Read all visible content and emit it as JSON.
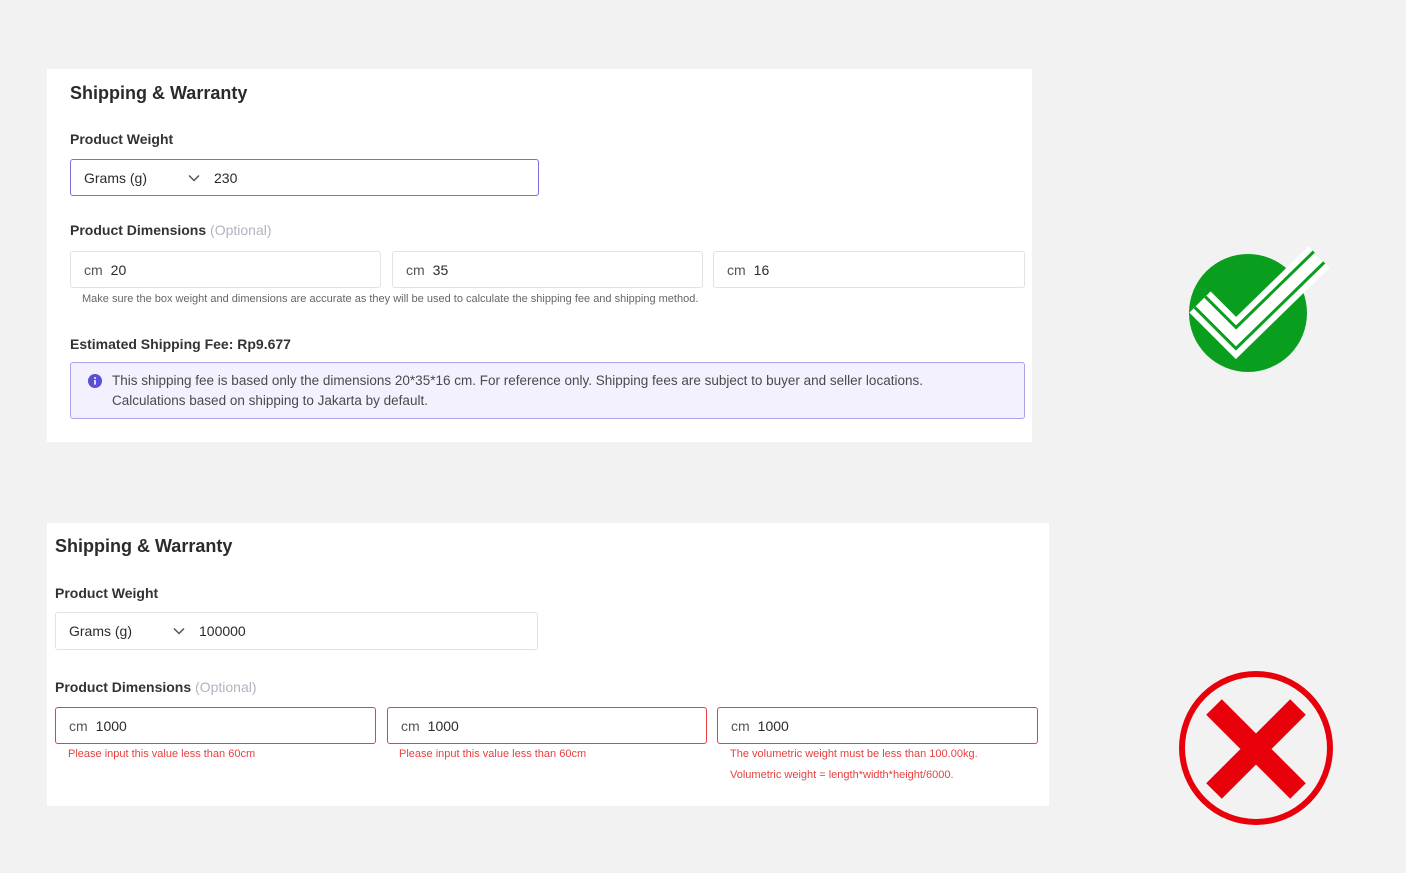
{
  "valid_example": {
    "section_title": "Shipping & Warranty",
    "weight_label": "Product Weight",
    "weight_unit": "Grams (g)",
    "weight_value": "230",
    "dimensions_label": "Product Dimensions",
    "dimensions_optional": "(Optional)",
    "dimensions": [
      {
        "unit": "cm",
        "value": "20"
      },
      {
        "unit": "cm",
        "value": "35"
      },
      {
        "unit": "cm",
        "value": "16"
      }
    ],
    "dimensions_hint": "Make sure the box weight and dimensions are accurate as they will be used to calculate the shipping fee and shipping method.",
    "shipping_fee_label": "Estimated Shipping Fee: Rp9.677",
    "info_line1": "This shipping fee is based only the dimensions 20*35*16 cm. For reference only. Shipping fees are subject to buyer and seller locations.",
    "info_line2": "Calculations based on shipping to Jakarta by default."
  },
  "invalid_example": {
    "section_title": "Shipping & Warranty",
    "weight_label": "Product Weight",
    "weight_unit": "Grams (g)",
    "weight_value": "100000",
    "dimensions_label": "Product Dimensions",
    "dimensions_optional": "(Optional)",
    "dimensions": [
      {
        "unit": "cm",
        "value": "1000",
        "error": "Please input this value less than 60cm"
      },
      {
        "unit": "cm",
        "value": "1000",
        "error": "Please input this value less than 60cm"
      },
      {
        "unit": "cm",
        "value": "1000",
        "error": "The volumetric weight must be less than 100.00kg.",
        "error2": "Volumetric weight = length*width*height/6000."
      }
    ]
  },
  "icons": {
    "valid": "check-circle-icon",
    "invalid": "x-circle-icon",
    "info": "info-icon",
    "dropdown": "chevron-down-icon"
  },
  "colors": {
    "accent": "#7b6fe0",
    "error": "#e84040",
    "check_green": "#0a9e1f",
    "cross_red": "#e8000b",
    "info_bg": "#f2f1fd"
  }
}
